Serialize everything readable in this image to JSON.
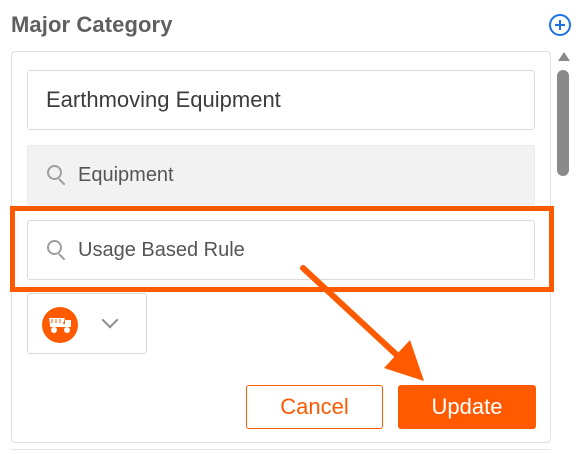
{
  "section": {
    "title": "Major Category",
    "add_icon": "plus-circle-icon"
  },
  "form": {
    "category_name": "Earthmoving Equipment",
    "equipment_field": {
      "label": "Equipment",
      "icon": "search-icon"
    },
    "rule_field": {
      "label": "Usage Based Rule",
      "icon": "search-icon"
    },
    "icon_picker": {
      "selected_icon": "dump-truck-icon",
      "dropdown_icon": "chevron-down-icon"
    }
  },
  "actions": {
    "cancel_label": "Cancel",
    "update_label": "Update"
  },
  "colors": {
    "accent": "#ff5a00",
    "link": "#1a73e8",
    "muted": "#9e9e9e"
  }
}
